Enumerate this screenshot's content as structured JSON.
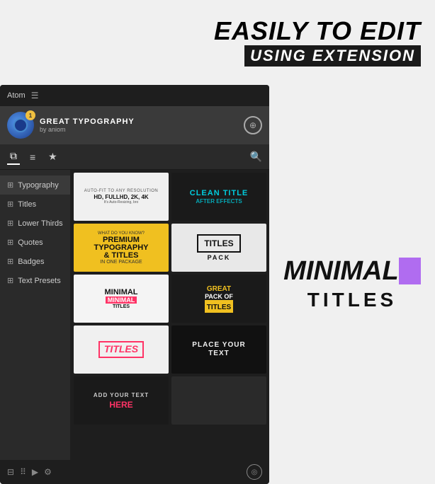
{
  "banner": {
    "line1": "EASILY TO EDIT",
    "line2": "USING EXTENSION"
  },
  "panel": {
    "header_title": "Atom",
    "profile_name": "GREAT TYPOGRAPHY",
    "profile_sub": "by aniom",
    "badge": "1"
  },
  "toolbar": {
    "icons": [
      "sliders",
      "layers",
      "star"
    ]
  },
  "sidebar": {
    "items": [
      {
        "label": "Typography"
      },
      {
        "label": "Titles"
      },
      {
        "label": "Lower Thirds"
      },
      {
        "label": "Quotes"
      },
      {
        "label": "Badges"
      },
      {
        "label": "Text Presets"
      }
    ]
  },
  "grid": {
    "cells": [
      [
        "auto-fit",
        "clean-title"
      ],
      [
        "what-do-you",
        "titles-pack"
      ],
      [
        "minimal-titles",
        "great-pack"
      ],
      [
        "titles-pink",
        "place-your-text"
      ],
      [
        "add-your-text",
        ""
      ]
    ]
  },
  "right_panel": {
    "word1": "MINIMAL",
    "word2": "TITLES"
  }
}
